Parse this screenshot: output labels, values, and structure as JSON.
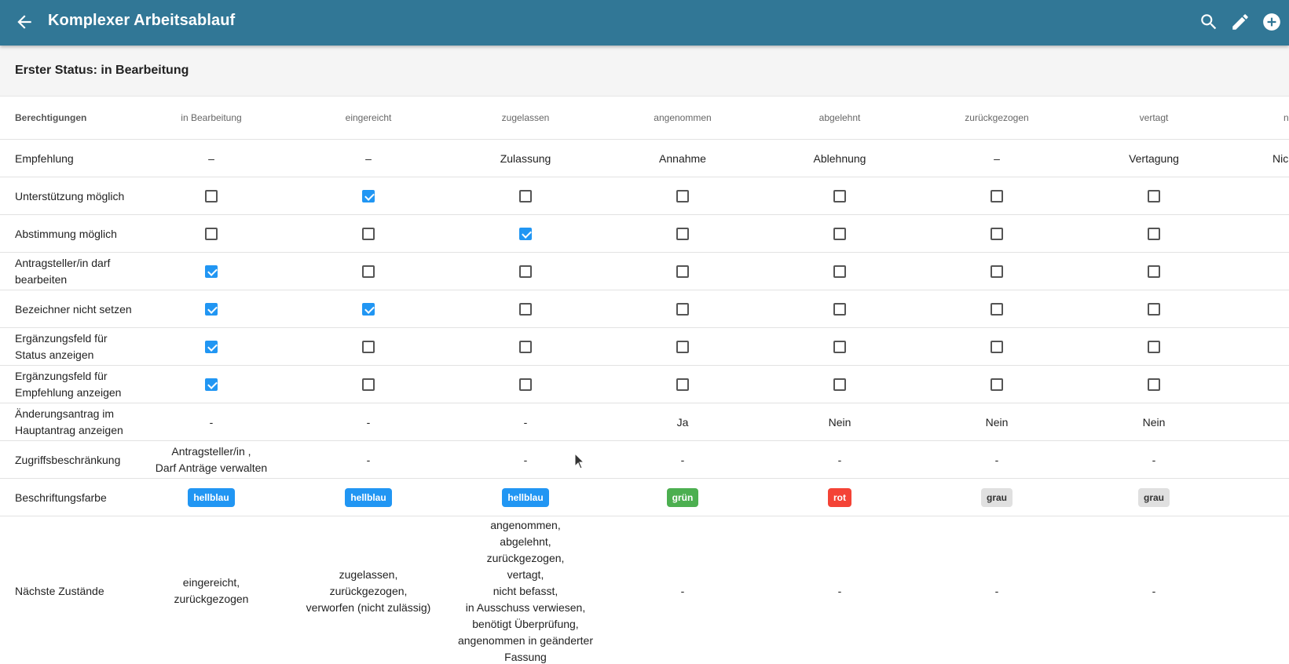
{
  "header": {
    "title": "Komplexer Arbeitsablauf",
    "color": "#317796"
  },
  "first_status": "Erster Status: in Bearbeitung",
  "table": {
    "corner": "Berechtigungen",
    "columns": [
      "in Bearbeitung",
      "eingereicht",
      "zugelassen",
      "angenommen",
      "abgelehnt",
      "zurückgezogen",
      "vertagt",
      "n"
    ],
    "rows": {
      "empfehlung": {
        "label": "Empfehlung",
        "values": [
          "–",
          "–",
          "Zulassung",
          "Annahme",
          "Ablehnung",
          "–",
          "Vertagung",
          "Nic"
        ]
      },
      "unterstuetzung": {
        "label": "Unterstützung möglich",
        "values": [
          false,
          true,
          false,
          false,
          false,
          false,
          false
        ]
      },
      "abstimmung": {
        "label": "Abstimmung möglich",
        "values": [
          false,
          false,
          true,
          false,
          false,
          false,
          false
        ]
      },
      "antragsteller": {
        "label": "Antragsteller/in darf bearbeiten",
        "values": [
          true,
          false,
          false,
          false,
          false,
          false,
          false
        ]
      },
      "bezeichner": {
        "label": "Bezeichner nicht setzen",
        "values": [
          true,
          true,
          false,
          false,
          false,
          false,
          false
        ]
      },
      "ergaenzung_status": {
        "label": "Ergänzungsfeld für Status anzeigen",
        "values": [
          true,
          false,
          false,
          false,
          false,
          false,
          false
        ]
      },
      "ergaenzung_empfehlung": {
        "label": "Ergänzungsfeld für Empfehlung anzeigen",
        "values": [
          true,
          false,
          false,
          false,
          false,
          false,
          false
        ]
      },
      "aenderungsantrag": {
        "label": "Änderungsantrag im Hauptantrag anzeigen",
        "values": [
          "-",
          "-",
          "-",
          "Ja",
          "Nein",
          "Nein",
          "Nein"
        ]
      },
      "zugriff": {
        "label": "Zugriffsbeschränkung",
        "values": [
          "Antragsteller/in ,\nDarf Anträge verwalten",
          "-",
          "-",
          "-",
          "-",
          "-",
          "-"
        ]
      },
      "farbe": {
        "label": "Beschriftungsfarbe",
        "values": [
          {
            "text": "hellblau",
            "bg": "#2196f3",
            "fg": "#ffffff"
          },
          {
            "text": "hellblau",
            "bg": "#2196f3",
            "fg": "#ffffff"
          },
          {
            "text": "hellblau",
            "bg": "#2196f3",
            "fg": "#ffffff"
          },
          {
            "text": "grün",
            "bg": "#4caf50",
            "fg": "#ffffff"
          },
          {
            "text": "rot",
            "bg": "#f44336",
            "fg": "#ffffff"
          },
          {
            "text": "grau",
            "bg": "#e0e0e0",
            "fg": "#333333"
          },
          {
            "text": "grau",
            "bg": "#e0e0e0",
            "fg": "#333333"
          }
        ]
      },
      "naechste": {
        "label": "Nächste Zustände",
        "values": [
          "eingereicht,\nzurückgezogen",
          "zugelassen,\nzurückgezogen,\nverworfen (nicht zulässig)",
          "angenommen,\nabgelehnt,\nzurückgezogen,\nvertagt,\nnicht befasst,\nin Ausschuss verwiesen,\nbenötigt Überprüfung,\nangenommen in geänderter\nFassung",
          "-",
          "-",
          "-",
          "-"
        ]
      }
    }
  },
  "icons": {
    "back": "arrow-back-icon",
    "search": "search-icon",
    "edit": "pencil-icon",
    "add": "add-circle-icon",
    "cursor": "mouse-cursor-icon"
  }
}
